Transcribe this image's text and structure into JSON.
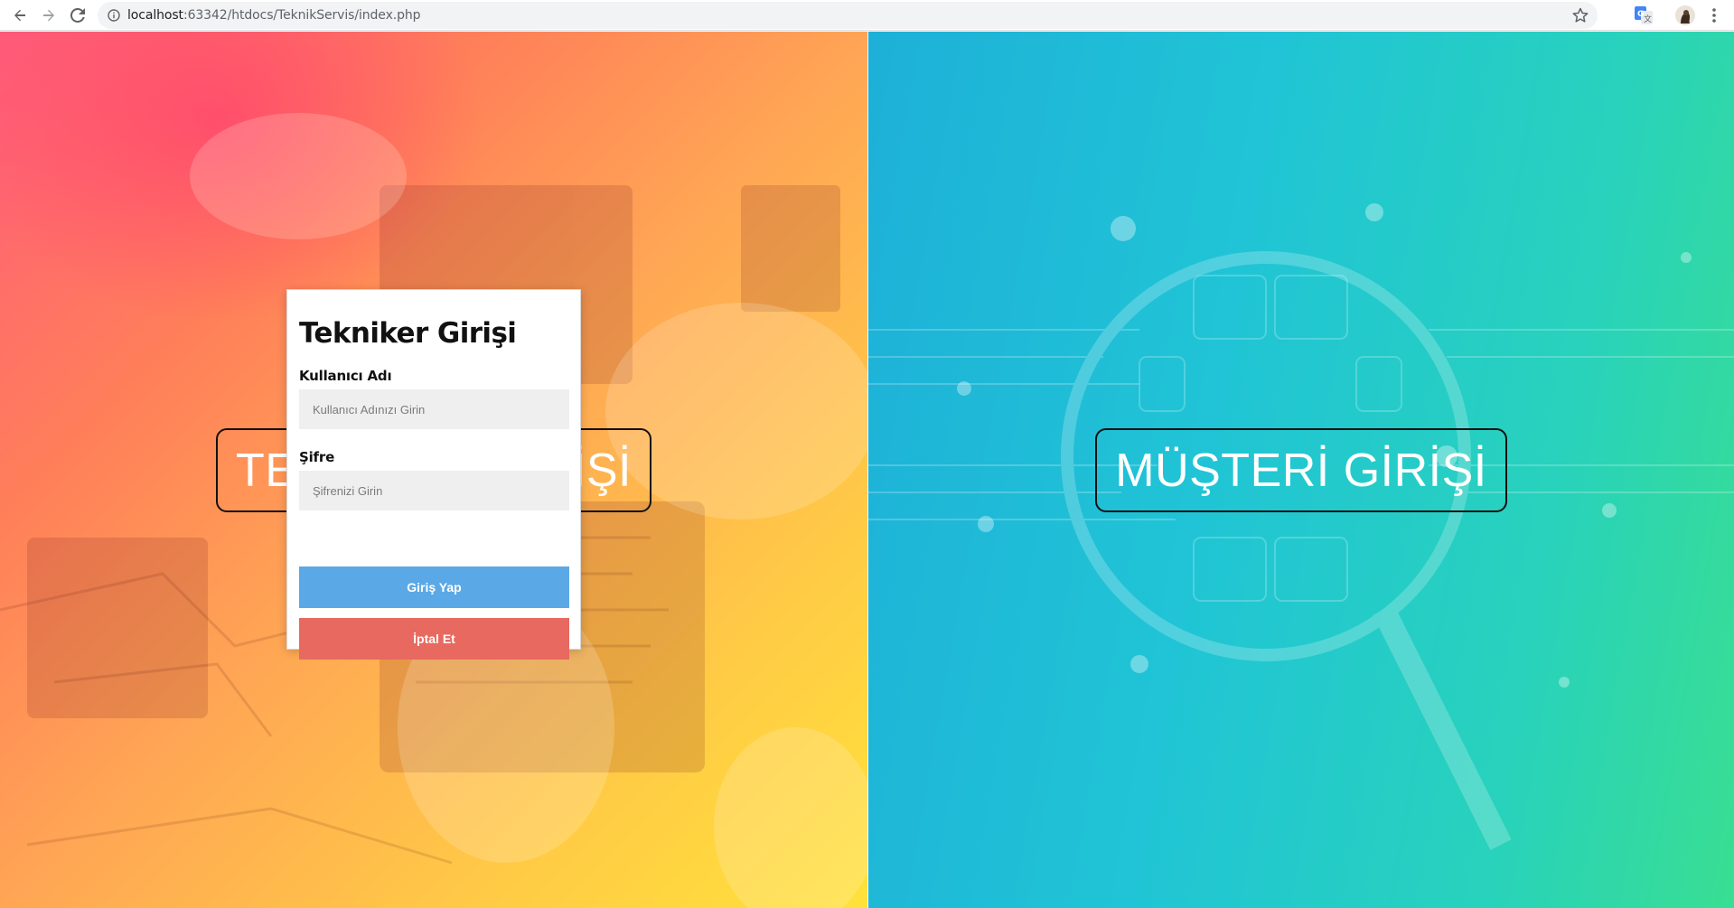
{
  "browser": {
    "url_host": "localhost",
    "url_rest": ":63342/htdocs/TeknikServis/index.php",
    "icons": {
      "back": "arrow-left-icon",
      "forward": "arrow-right-icon",
      "reload": "reload-icon",
      "info": "info-icon",
      "bookmark": "star-icon",
      "translate": "translate-icon",
      "menu": "kebab-menu-icon"
    }
  },
  "page": {
    "technician_button": "TEKNİKER GİRİŞİ",
    "customer_button": "MÜŞTERİ GİRİŞİ"
  },
  "modal": {
    "title": "Tekniker Girişi",
    "username_label": "Kullanıcı Adı",
    "username_placeholder": "Kullanıcı Adınızı Girin",
    "password_label": "Şifre",
    "password_placeholder": "Şifrenizi Girin",
    "login_button": "Giriş Yap",
    "cancel_button": "İptal Et"
  },
  "colors": {
    "login_button": "#5aa9e6",
    "cancel_button": "#e8695f",
    "left_panel_gradient": [
      "#ff5c7a",
      "#ffe23a"
    ],
    "right_panel_gradient": [
      "#1eb0d8",
      "#39de92"
    ]
  }
}
